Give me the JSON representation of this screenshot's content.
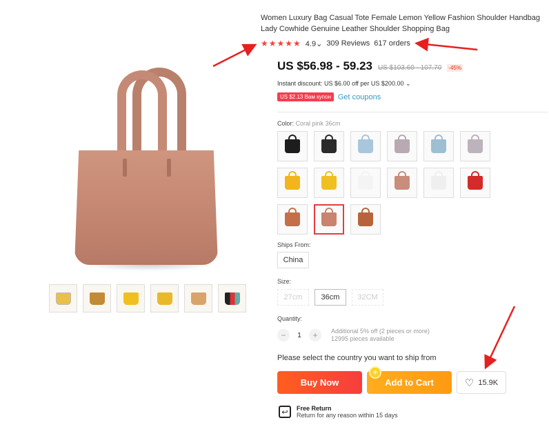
{
  "product": {
    "title": "Women Luxury Bag Casual Tote Female Lemon Yellow Fashion Shoulder Handbag Lady Cowhide Genuine Leather Shoulder Shopping Bag",
    "stars": "★★★★★",
    "rating": "4.9",
    "rating_chevron": "⌄",
    "reviews": "309 Reviews",
    "orders": "617 orders"
  },
  "pricing": {
    "price": "US $56.98 - 59.23",
    "original_price": "US $103.60 - 107.70",
    "discount": "-45%",
    "instant_discount": "Instant discount: US $6.00 off per US $200.00 ⌄",
    "coupon": "US $2.13 Вам купон",
    "get_coupons": "Get coupons"
  },
  "options": {
    "color_label": "Color:",
    "color_selected": "Coral pink 36cm",
    "swatches": [
      {
        "color": "#1d1d1d",
        "icon": "black-bag"
      },
      {
        "color": "#2a2a2a",
        "icon": "black-bag"
      },
      {
        "color": "#a9c6dc",
        "icon": "light-blue-bag"
      },
      {
        "color": "#b8a9b3",
        "icon": "mauve-bag"
      },
      {
        "color": "#9ebfd2",
        "icon": "blue-bag"
      },
      {
        "color": "#bcb3bd",
        "icon": "lilac-bag"
      },
      {
        "color": "#f2b51b",
        "icon": "yellow-bag"
      },
      {
        "color": "#f0bf21",
        "icon": "yellow-bag"
      },
      {
        "color": "#f4f4f4",
        "icon": "white-bag"
      },
      {
        "color": "#c98d7b",
        "icon": "pink-bag"
      },
      {
        "color": "#efefef",
        "icon": "white-bag"
      },
      {
        "color": "#d42a2a",
        "icon": "red-bag"
      },
      {
        "color": "#c56f49",
        "icon": "brown-bag"
      },
      {
        "color": "#c9836f",
        "icon": "coral-bag"
      },
      {
        "color": "#b7643d",
        "icon": "tan-bag"
      }
    ],
    "selected_swatch_index": 13,
    "ships_from_label": "Ships From:",
    "ships_from_value": "China",
    "size_label": "Size:",
    "sizes": [
      "27cm",
      "36cm",
      "32CM"
    ],
    "selected_size": "36cm"
  },
  "quantity": {
    "label": "Quantity:",
    "minus": "−",
    "value": "1",
    "plus": "+",
    "note1": "Additional 5% off (2 pieces or more)",
    "note2": "12995 pieces available"
  },
  "actions": {
    "ship_message": "Please select the country you want to ship from",
    "buy_now": "Buy Now",
    "add_to_cart": "Add to Cart",
    "wishlist_count": "15.9K",
    "heart_icon": "♡",
    "coin_icon": "+"
  },
  "return": {
    "icon": "↩",
    "title": "Free Return",
    "subtitle": "Return for any reason within 15 days"
  },
  "colors": {
    "accent_red": "#f53d4f",
    "buy_orange": "#ff5f1f",
    "cart_orange": "#ffad1f",
    "annotation_red": "#e62020"
  }
}
